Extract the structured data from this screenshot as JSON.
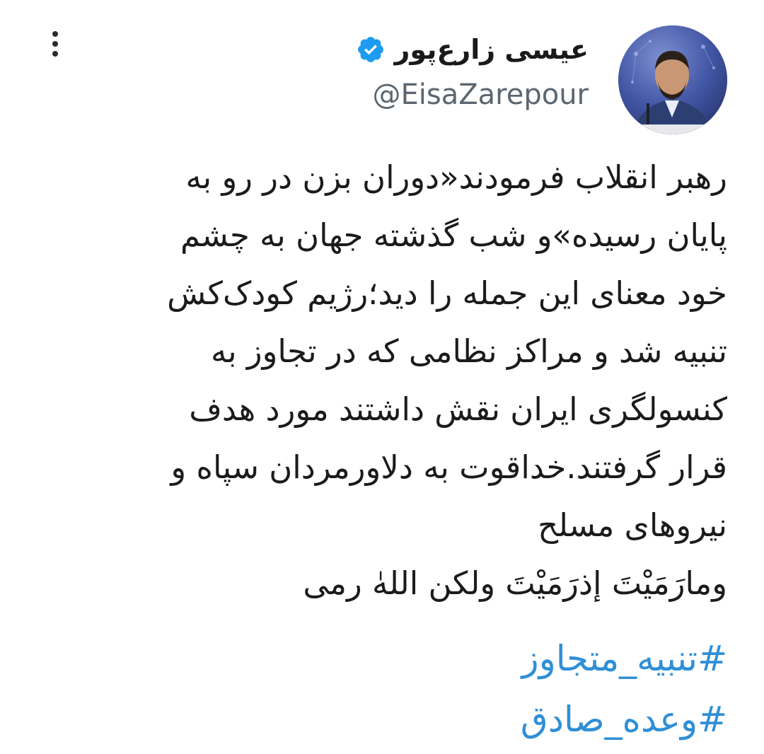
{
  "author": {
    "display_name": "عیسی زارع‌پور",
    "handle": "@EisaZarepour",
    "verified": true
  },
  "menu": {
    "icon": "more-vertical-icon"
  },
  "tweet": {
    "lines": [
      "رهبر انقلاب فرمودند«دوران بزن در رو به",
      "پایان رسیده»و شب گذشته جهان به چشم",
      "خود معنای این جمله را دید؛رژیم کودک‌کش",
      "تنبیه شد و مراکز نظامی که در تجاوز به",
      "کنسولگری ایران نقش داشتند مورد هدف",
      "قرار گرفتند.خداقوت به دلاورمردان سپاه و",
      "نیروهای مسلح",
      "ومارَمَیْتَ إذرَمَیْتَ ولکن اللهٰ رمی"
    ],
    "hashtags": [
      "#تنبیه_متجاوز",
      "#وعده_صادق"
    ]
  },
  "colors": {
    "hashtag": "#2f8fd6",
    "verified_badge": "#1d9bf0",
    "handle": "#5b6670",
    "text": "#1b1b1b"
  }
}
